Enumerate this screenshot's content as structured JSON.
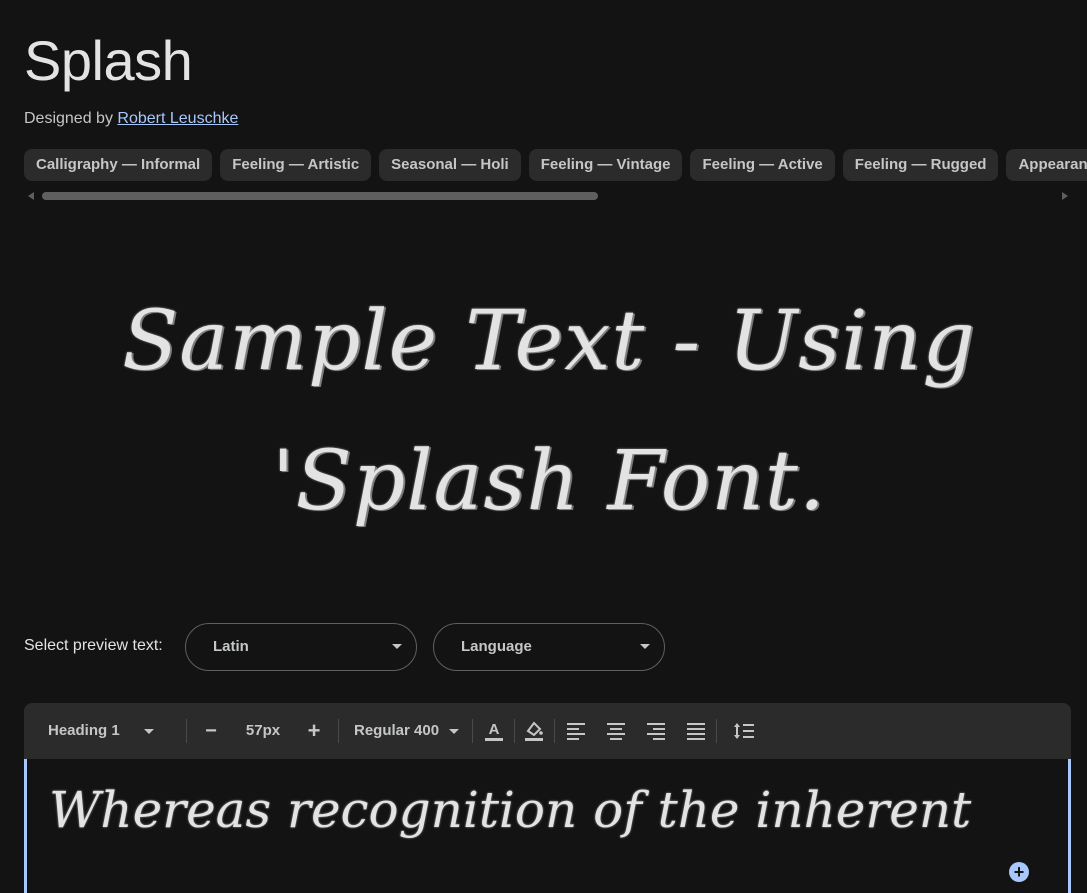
{
  "font": {
    "title": "Splash",
    "designed_by_label": "Designed by",
    "designer": "Robert Leuschke"
  },
  "tags": [
    "Calligraphy — Informal",
    "Feeling — Artistic",
    "Seasonal — Holi",
    "Feeling — Vintage",
    "Feeling — Active",
    "Feeling — Rugged",
    "Appearance — "
  ],
  "hero_sample": "Sample Text - Using 'Splash Font.",
  "preview": {
    "label": "Select preview text:",
    "script_select": "Latin",
    "language_select": "Language"
  },
  "toolbar": {
    "style_select": "Heading 1",
    "decrease": "−",
    "size_value": "57px",
    "increase": "+",
    "weight_select": "Regular 400",
    "icons": [
      "text-color-icon",
      "highlight-color-icon",
      "align-left-icon",
      "align-center-icon",
      "align-right-icon",
      "align-justify-icon",
      "line-height-icon"
    ]
  },
  "editor": {
    "text": "Whereas recognition of the inherent"
  },
  "colors": {
    "background": "#131313",
    "chip": "#2b2b2b",
    "accent": "#a8c7fa"
  }
}
